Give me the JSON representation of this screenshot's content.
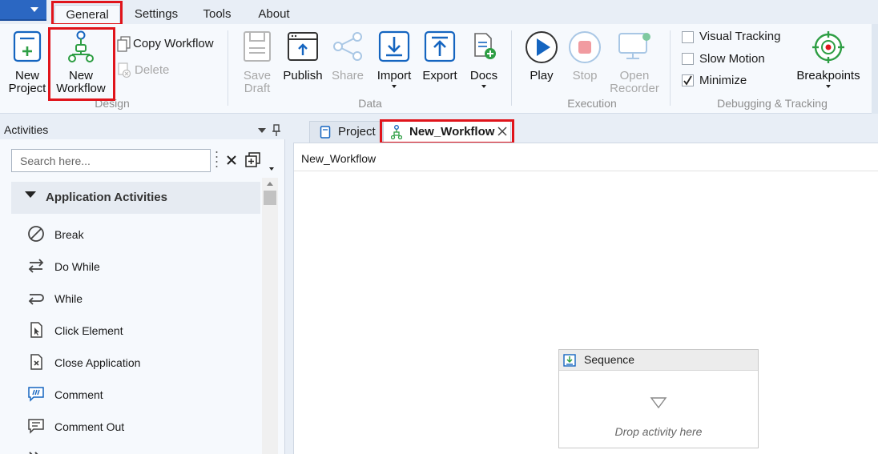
{
  "menu": {
    "tabs": [
      {
        "label": "General"
      },
      {
        "label": "Settings"
      },
      {
        "label": "Tools"
      },
      {
        "label": "About"
      }
    ]
  },
  "ribbon": {
    "design": {
      "label": "Design",
      "new_project": "New\nProject",
      "new_workflow": "New\nWorkflow",
      "copy_workflow": "Copy Workflow",
      "delete": "Delete"
    },
    "data": {
      "label": "Data",
      "save_draft": "Save\nDraft",
      "publish": "Publish",
      "share": "Share",
      "import": "Import",
      "export": "Export",
      "docs": "Docs"
    },
    "execution": {
      "label": "Execution",
      "play": "Play",
      "stop": "Stop",
      "open_recorder": "Open\nRecorder"
    },
    "debugging": {
      "label": "Debugging & Tracking",
      "visual_tracking": "Visual Tracking",
      "slow_motion": "Slow Motion",
      "minimize": "Minimize",
      "breakpoints": "Breakpoints"
    }
  },
  "activities": {
    "title": "Activities",
    "search_placeholder": "Search here...",
    "category": "Application Activities",
    "items": [
      {
        "label": "Break"
      },
      {
        "label": "Do While"
      },
      {
        "label": "While"
      },
      {
        "label": "Click Element"
      },
      {
        "label": "Close Application"
      },
      {
        "label": "Comment"
      },
      {
        "label": "Comment Out"
      }
    ]
  },
  "documents": {
    "tabs": [
      {
        "label": "Project"
      },
      {
        "label": "New_Workflow"
      }
    ],
    "breadcrumb": "New_Workflow",
    "sequence_title": "Sequence",
    "drop_hint": "Drop activity here"
  },
  "colors": {
    "accent_blue": "#1565c0",
    "highlight_red": "#e0141b",
    "app_button": "#2b67c2"
  }
}
